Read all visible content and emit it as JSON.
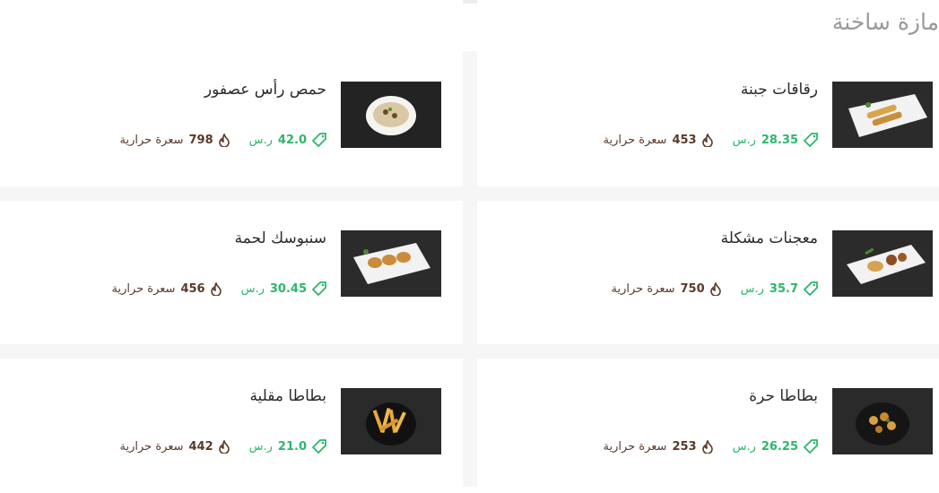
{
  "section": {
    "title": "مازة ساخنة"
  },
  "labels": {
    "currency": "ر.س",
    "calories_suffix": "سعرة حرارية"
  },
  "colors": {
    "price": "#2bb76a",
    "calories": "#5a3a2a",
    "title": "#9a9a9a"
  },
  "items": [
    {
      "name": "رقاقات جبنة",
      "price": "28.35",
      "calories": "453",
      "image": "cheese-rolls-plate"
    },
    {
      "name": "حمص رأس عصفور",
      "price": "42.0",
      "calories": "798",
      "image": "hummus-bowl"
    },
    {
      "name": "معجنات مشكلة",
      "price": "35.7",
      "calories": "750",
      "image": "mixed-pastries-plate"
    },
    {
      "name": "سنبوسك لحمة",
      "price": "30.45",
      "calories": "456",
      "image": "meat-sambousek-plate"
    },
    {
      "name": "بطاطا حرة",
      "price": "26.25",
      "calories": "253",
      "image": "spicy-potatoes-bowl"
    },
    {
      "name": "بطاطا مقلية",
      "price": "21.0",
      "calories": "442",
      "image": "french-fries-bowl"
    }
  ]
}
